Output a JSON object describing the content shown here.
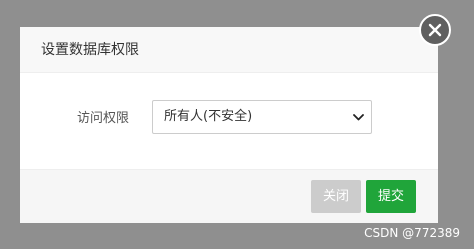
{
  "dialog": {
    "title": "设置数据库权限",
    "close_icon": "close-icon",
    "access": {
      "label": "访问权限",
      "selected": "所有人(不安全)",
      "arrow_icon": "chevron-down-icon"
    },
    "footer": {
      "close_label": "关闭",
      "submit_label": "提交"
    }
  },
  "watermark": "CSDN @772389",
  "colors": {
    "overlay": "#8f8f8f",
    "header_bg": "#f8f8f8",
    "footer_bg": "#f6f6f6",
    "close_button": "#cccccc",
    "submit_button": "#20a53a",
    "close_circle": "#5f5f5f"
  }
}
